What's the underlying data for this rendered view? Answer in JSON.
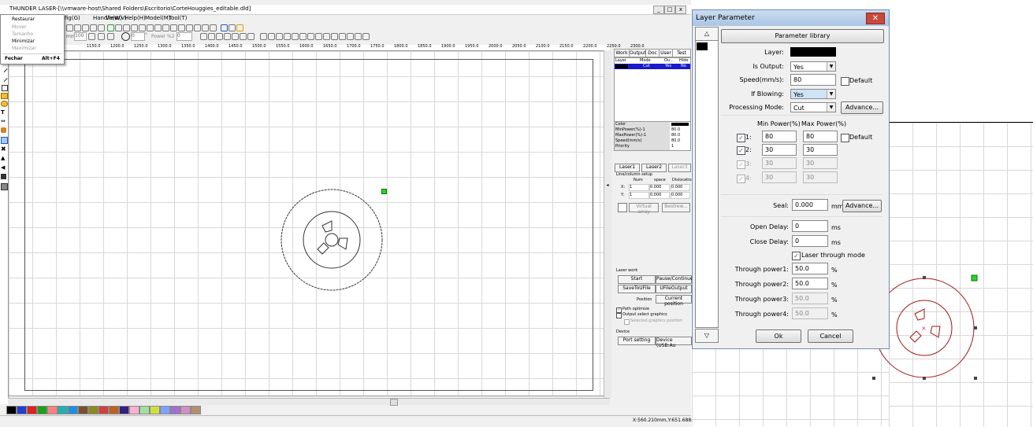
{
  "app": {
    "title": "THUNDER LASER-[\\\\vmware-host\\Shared Folders\\Escritorio\\CorteHouggies_editable.dld]",
    "window_min": "_",
    "window_max": "□",
    "window_close": "x"
  },
  "menubar": {
    "items": [
      "Handle(W)",
      "View(V)",
      "Help(H)",
      "Model(M)",
      "Tool(T)"
    ],
    "cfg_partial": "fig(G)"
  },
  "system_menu": {
    "items": [
      {
        "label": "Restaurar",
        "shortcut": "",
        "enabled": true
      },
      {
        "label": "Mover",
        "shortcut": "",
        "enabled": false
      },
      {
        "label": "Tamanho",
        "shortcut": "",
        "enabled": false
      },
      {
        "label": "Minimizar",
        "shortcut": "",
        "enabled": true
      },
      {
        "label": "Maximizar",
        "shortcut": "",
        "enabled": false
      },
      {
        "label": "Fechar",
        "shortcut": "Alt+F4",
        "enabled": true
      }
    ]
  },
  "toolbar2": {
    "width_value": "100",
    "height_value": "100",
    "angle_value": "0",
    "unit": "mm",
    "degree": "°",
    "power_label": "Power %2",
    "power_value": "0"
  },
  "ruler_top": {
    "labels": [
      "1150.0",
      "1200.0",
      "1250.0",
      "1300.0",
      "1350.0",
      "1400.0",
      "1450.0",
      "1500.0",
      "1550.0",
      "1600.0",
      "1650.0",
      "1700.0",
      "1750.0",
      "1800.0",
      "1850.0",
      "1900.0",
      "1950.0",
      "2000.0",
      "2050.0",
      "2100.0",
      "2150.0",
      "2200.0",
      "2250.0",
      "2300.0"
    ]
  },
  "right_panel": {
    "tabs": [
      "Work",
      "Output",
      "Doc",
      "User",
      "Test"
    ],
    "layer_table_headers": [
      "Layer",
      "Mode",
      "Ou...",
      "Hide"
    ],
    "layer_row": {
      "mode": "Cut",
      "output": "Yes",
      "hide": "No"
    },
    "props": [
      {
        "label": "Color",
        "value": ""
      },
      {
        "label": "MinPower(%)-1",
        "value": "80.0"
      },
      {
        "label": "MaxPower(%)-1",
        "value": "80.0"
      },
      {
        "label": "Speed(mm/s)",
        "value": "80.0"
      },
      {
        "label": "Priority",
        "value": "1"
      }
    ],
    "laser_tabs": [
      "Laser1",
      "Laser2",
      "Laser3"
    ],
    "array_title": "Line/column setup",
    "array_headers": [
      "Num",
      "space",
      "Dislocation"
    ],
    "array_rows": [
      {
        "axis": "X:",
        "num": "1",
        "space": "0.000",
        "disloc": "0.000"
      },
      {
        "axis": "Y:",
        "num": "1",
        "space": "0.000",
        "disloc": "0.000"
      }
    ],
    "virtual_array": "Virtual array",
    "bestrew": "Bestrew...",
    "laser_work_title": "Laser work",
    "start": "Start",
    "pause": "Pause/Continue",
    "save_to_ufile": "SaveToUFile",
    "ufile_output": "UFileOutput",
    "position_label": "Position",
    "current_position": "Current position",
    "path_optimize": "Path optimize",
    "output_select": "Output select graphics",
    "selected_pos": "Selected graphics position",
    "device_title": "Device",
    "port_setting": "Port setting",
    "device_value": "Device (USB:Au"
  },
  "status": {
    "coords": "X:560.210mm,Y:651.688m"
  },
  "palette": {
    "colors": [
      "#000000",
      "#1f3fcf",
      "#e02020",
      "#1aa01a",
      "#ff8080",
      "#20b0b0",
      "#1e8fe0",
      "#7a5030",
      "#8a8a20",
      "#d04040",
      "#c06020",
      "#302080",
      "#ffb0d0",
      "#a0e0a0",
      "#d0e040",
      "#80a0ff",
      "#a070d0",
      "#d090c0",
      "#b09070"
    ]
  },
  "dialog": {
    "title": "Layer Parameter",
    "close": "✕",
    "param_library": "Parameter library",
    "layer_label": "Layer:",
    "layer_color": "#000000",
    "is_output_label": "Is Output:",
    "is_output": "Yes",
    "speed_label": "Speed(mm/s):",
    "speed": "80",
    "default_label": "Default",
    "if_blowing_label": "If Blowing:",
    "if_blowing": "Yes",
    "mode_label": "Processing Mode:",
    "mode": "Cut",
    "advance": "Advance...",
    "min_power_label": "Min Power(%)",
    "max_power_label": "Max Power(%)",
    "power_rows": [
      {
        "idx": "1:",
        "min": "80",
        "max": "80",
        "checked": true,
        "enabled": true
      },
      {
        "idx": "2:",
        "min": "30",
        "max": "30",
        "checked": true,
        "enabled": true
      },
      {
        "idx": "3:",
        "min": "30",
        "max": "30",
        "checked": true,
        "enabled": false
      },
      {
        "idx": "4:",
        "min": "30",
        "max": "30",
        "checked": true,
        "enabled": false
      }
    ],
    "seal_label": "Seal:",
    "seal": "0.000",
    "mm": "mm",
    "open_delay_label": "Open Delay:",
    "open_delay": "0",
    "close_delay_label": "Close Delay:",
    "close_delay": "0",
    "ms": "ms",
    "laser_through_mode": "Laser through mode",
    "through": [
      {
        "label": "Through power1:",
        "value": "50.0",
        "enabled": true
      },
      {
        "label": "Through power2:",
        "value": "50.0",
        "enabled": true
      },
      {
        "label": "Through power3:",
        "value": "50.0",
        "enabled": false
      },
      {
        "label": "Through power4:",
        "value": "50.0",
        "enabled": false
      }
    ],
    "percent": "%",
    "ok": "Ok",
    "cancel": "Cancel"
  }
}
